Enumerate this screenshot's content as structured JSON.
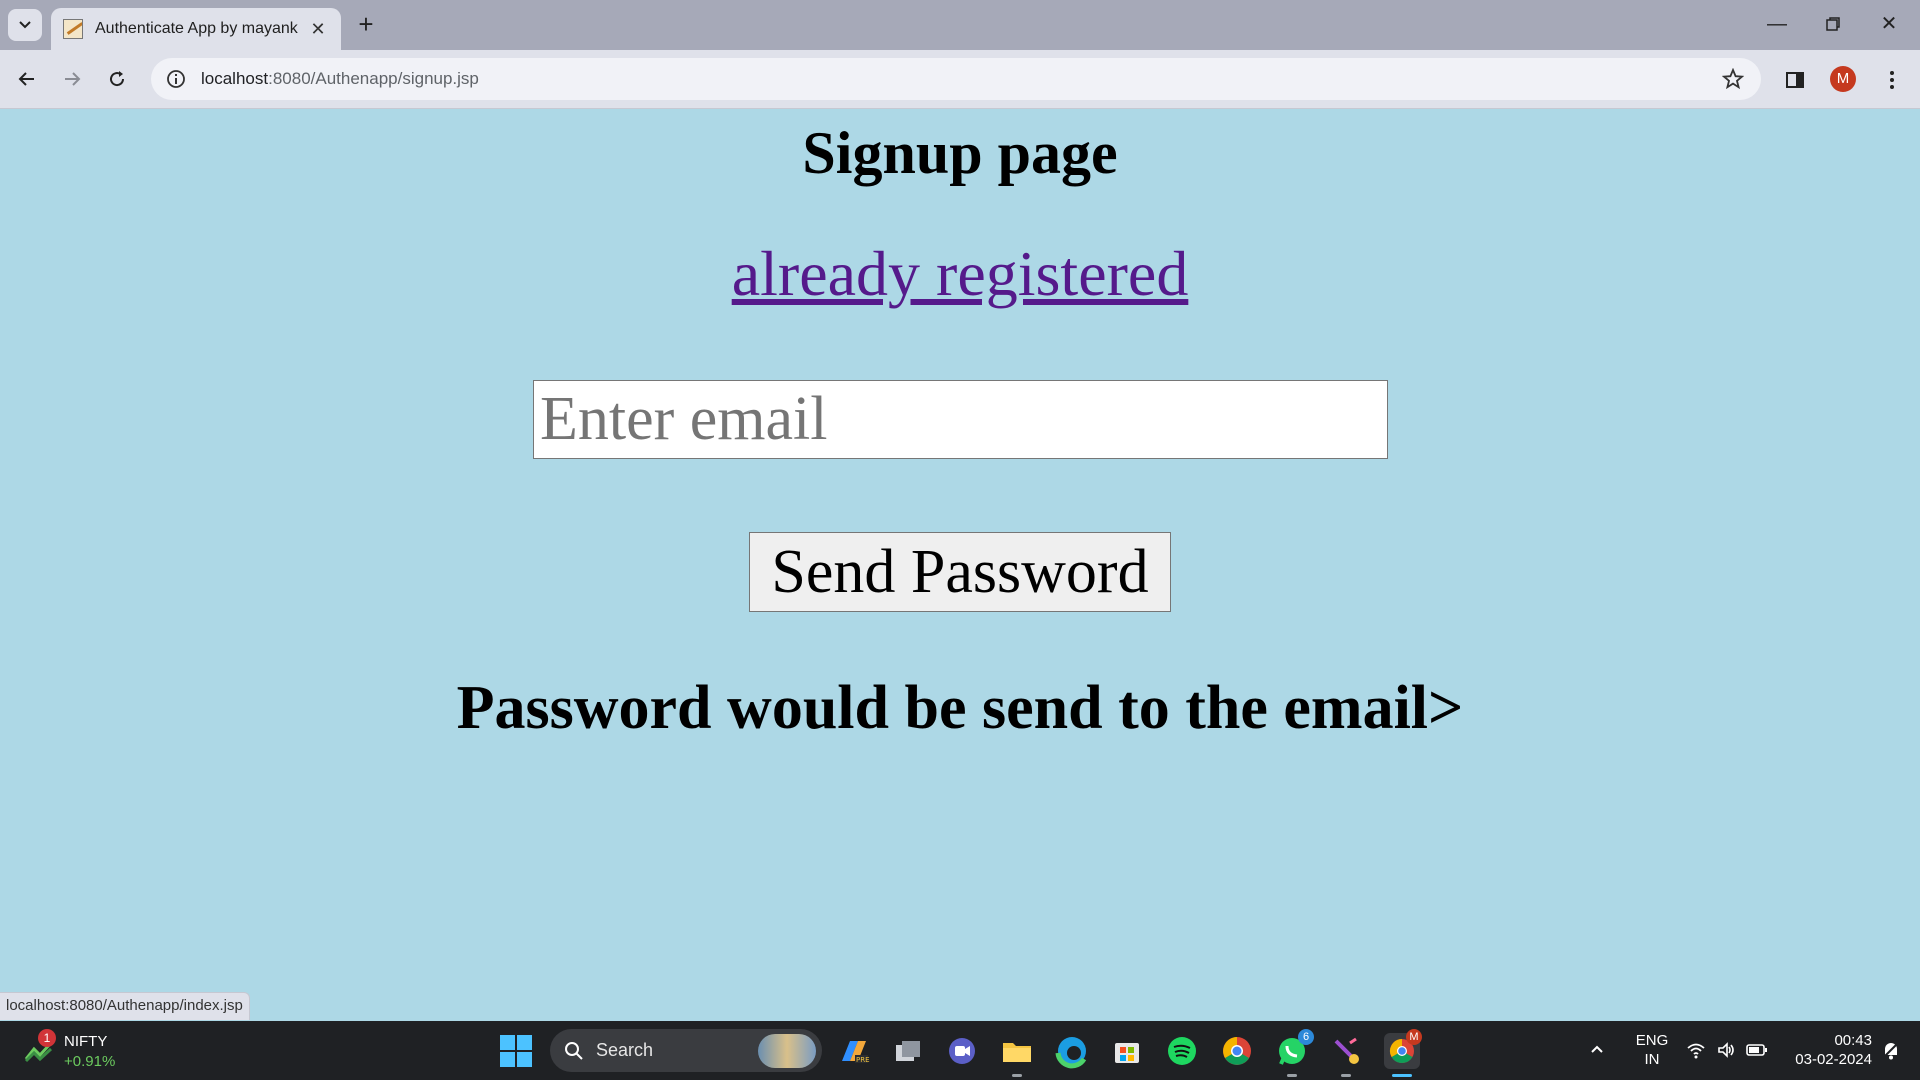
{
  "browser": {
    "tab_title": "Authenticate App by mayank",
    "url_host": "localhost",
    "url_rest": ":8080/Authenapp/signup.jsp",
    "status_url": "localhost:8080/Authenapp/index.jsp",
    "profile_initial": "M"
  },
  "page": {
    "title": "Signup page",
    "login_link": "already registered",
    "email_placeholder": "Enter email",
    "send_button": "Send Password",
    "info_text": "Password would be send to the email>",
    "background_color": "#add8e6",
    "link_color": "#551a8b"
  },
  "taskbar": {
    "widget_name": "NIFTY",
    "widget_change": "+0.91%",
    "widget_badge": "1",
    "search_label": "Search",
    "whatsapp_badge": "6",
    "chrome_badge": "M",
    "lang_line1": "ENG",
    "lang_line2": "IN",
    "time": "00:43",
    "date": "03-02-2024"
  }
}
